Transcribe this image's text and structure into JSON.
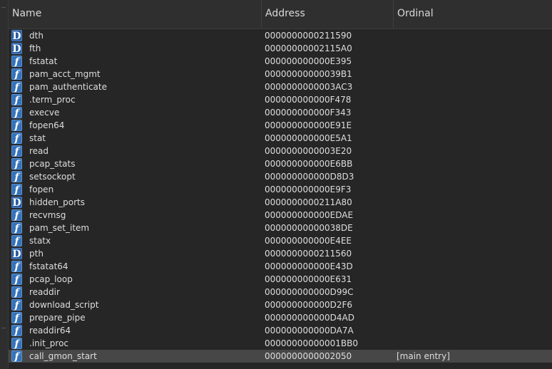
{
  "columns": {
    "name": "Name",
    "address": "Address",
    "ordinal": "Ordinal"
  },
  "rows": [
    {
      "type": "data",
      "name": "dth",
      "address": "0000000000211590",
      "ordinal": ""
    },
    {
      "type": "data",
      "name": "fth",
      "address": "00000000002115A0",
      "ordinal": ""
    },
    {
      "type": "func",
      "name": "fstatat",
      "address": "000000000000E395",
      "ordinal": ""
    },
    {
      "type": "func",
      "name": "pam_acct_mgmt",
      "address": "00000000000039B1",
      "ordinal": ""
    },
    {
      "type": "func",
      "name": "pam_authenticate",
      "address": "0000000000003AC3",
      "ordinal": ""
    },
    {
      "type": "func",
      "name": ".term_proc",
      "address": "000000000000F478",
      "ordinal": ""
    },
    {
      "type": "func",
      "name": "execve",
      "address": "000000000000F343",
      "ordinal": ""
    },
    {
      "type": "func",
      "name": "fopen64",
      "address": "000000000000E91E",
      "ordinal": ""
    },
    {
      "type": "func",
      "name": "stat",
      "address": "000000000000E5A1",
      "ordinal": ""
    },
    {
      "type": "func",
      "name": "read",
      "address": "0000000000003E20",
      "ordinal": ""
    },
    {
      "type": "func",
      "name": "pcap_stats",
      "address": "000000000000E6BB",
      "ordinal": ""
    },
    {
      "type": "func",
      "name": "setsockopt",
      "address": "000000000000D8D3",
      "ordinal": ""
    },
    {
      "type": "func",
      "name": "fopen",
      "address": "000000000000E9F3",
      "ordinal": ""
    },
    {
      "type": "data",
      "name": "hidden_ports",
      "address": "0000000000211A80",
      "ordinal": ""
    },
    {
      "type": "func",
      "name": "recvmsg",
      "address": "000000000000EDAE",
      "ordinal": ""
    },
    {
      "type": "func",
      "name": "pam_set_item",
      "address": "00000000000038DE",
      "ordinal": ""
    },
    {
      "type": "func",
      "name": "statx",
      "address": "000000000000E4EE",
      "ordinal": ""
    },
    {
      "type": "data",
      "name": "pth",
      "address": "0000000000211560",
      "ordinal": ""
    },
    {
      "type": "func",
      "name": "fstatat64",
      "address": "000000000000E43D",
      "ordinal": ""
    },
    {
      "type": "func",
      "name": "pcap_loop",
      "address": "000000000000E631",
      "ordinal": ""
    },
    {
      "type": "func",
      "name": "readdir",
      "address": "000000000000D99C",
      "ordinal": ""
    },
    {
      "type": "func",
      "name": "download_script",
      "address": "000000000000D2F6",
      "ordinal": ""
    },
    {
      "type": "func",
      "name": "prepare_pipe",
      "address": "000000000000D4AD",
      "ordinal": ""
    },
    {
      "type": "func",
      "name": "readdir64",
      "address": "000000000000DA7A",
      "ordinal": ""
    },
    {
      "type": "func",
      "name": ".init_proc",
      "address": "00000000000001BB0",
      "ordinal": ""
    },
    {
      "type": "func",
      "name": "call_gmon_start",
      "address": "0000000000002050",
      "ordinal": "[main entry]",
      "selected": true
    }
  ],
  "icons": {
    "func": "f",
    "data": "D"
  }
}
